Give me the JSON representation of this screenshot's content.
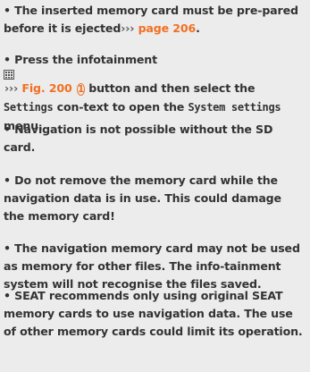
{
  "bullets": [
    {
      "marker": "•",
      "text_a": "The inserted memory card must be pre-pared before it is ejected",
      "ref_arrow": "›››",
      "ref_text": "page 206",
      "text_b": "."
    },
    {
      "marker": "•",
      "text_a": "Press the infotainment",
      "icon": "infotainment-grid-icon",
      "ref_arrow": "›››",
      "fig_ref": "Fig. 200",
      "callout": "1",
      "text_b": "button and then select the",
      "code_a": "Settings",
      "text_c": "con-text to open the",
      "code_b": "System settings",
      "text_d": "menu."
    },
    {
      "marker": "•",
      "text": "Navigation is not possible without the SD card."
    },
    {
      "marker": "•",
      "text": "Do not remove the memory card while the navigation data is in use. This could damage the memory card!"
    },
    {
      "marker": "•",
      "text": "The navigation memory card may not be used as memory for other files. The info-tainment system will not recognise the files saved."
    },
    {
      "marker": "•",
      "text": "SEAT recommends only using original SEAT memory cards to use navigation data. The use of other memory cards could limit its operation."
    }
  ],
  "colors": {
    "text": "#333333",
    "accent": "#f27023",
    "ref": "#5a5a5a",
    "background": "#ececec"
  }
}
